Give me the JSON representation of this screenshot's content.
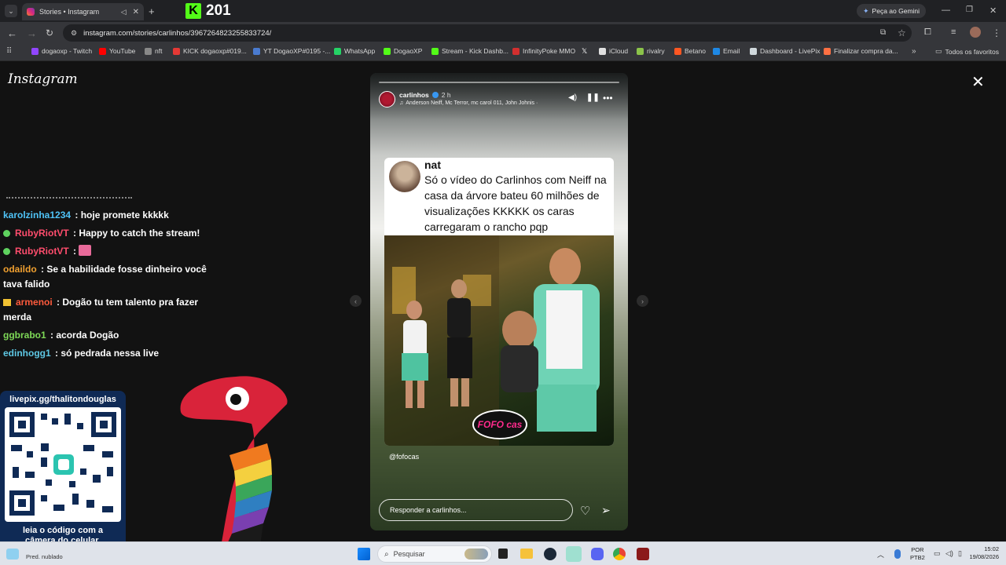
{
  "browser": {
    "tab_title": "Stories • Instagram",
    "url": "instagram.com/stories/carlinhos/3967264823255833724/",
    "gemini_label": "Peça ao Gemini",
    "kick_count": "201",
    "bookmarks": [
      {
        "label": "dogaoxp - Twitch",
        "color": "#9146ff"
      },
      {
        "label": "YouTube",
        "color": "#ff0000"
      },
      {
        "label": "nft",
        "color": "#888888"
      },
      {
        "label": "KICK dogaoxp#019...",
        "color": "#e53935"
      },
      {
        "label": "YT DogaoXP#0195 -...",
        "color": "#4a7bd0"
      },
      {
        "label": "WhatsApp",
        "color": "#25d366"
      },
      {
        "label": "DogaoXP",
        "color": "#53fc18"
      },
      {
        "label": "Stream - Kick Dashb...",
        "color": "#53fc18"
      },
      {
        "label": "InfinityPoke MMO",
        "color": "#d32f2f"
      },
      {
        "label": "",
        "color": "#dddddd"
      },
      {
        "label": "iCloud",
        "color": "#e0e0e0"
      },
      {
        "label": "rivalry",
        "color": "#8bc34a"
      },
      {
        "label": "Betano",
        "color": "#ff5722"
      },
      {
        "label": "Email",
        "color": "#1e88e5"
      },
      {
        "label": "Dashboard - LivePix",
        "color": "#cfd8dc"
      },
      {
        "label": "Finalizar compra da...",
        "color": "#ff7043"
      }
    ],
    "all_bookmarks": "Todos os favoritos"
  },
  "instagram": {
    "logo": "Instagram"
  },
  "chat": [
    {
      "user": "karolzinha1234",
      "color": "#4fc3f7",
      "badge": false,
      "text": ": hoje promete kkkkk"
    },
    {
      "user": "RubyRiotVT",
      "color": "#ff4d6d",
      "badge": true,
      "text": ": Happy to catch the stream!"
    },
    {
      "user": "RubyRiotVT",
      "color": "#ff4d6d",
      "badge": true,
      "text": ":"
    },
    {
      "user": "odaildo",
      "color": "#f0a030",
      "badge": false,
      "text": ": Se a habilidade fosse dinheiro você tava falido"
    },
    {
      "user": "armenoi",
      "color": "#ff5a3c",
      "badge": true,
      "text": ": Dogão tu tem talento pra fazer merda"
    },
    {
      "user": "ggbrabo1",
      "color": "#7ed957",
      "badge": false,
      "text": ": acorda Dogão"
    },
    {
      "user": "edinhogg1",
      "color": "#5ec8e5",
      "badge": false,
      "text": ": só pedrada nessa live"
    }
  ],
  "livepix": {
    "url": "livepix.gg/thalitondouglas",
    "caption": "leia o código com a câmera do celular."
  },
  "story": {
    "username": "carlinhos",
    "time": "2 h",
    "music": "Anderson Neiff, Mc Terror, mc carol 011, John Johnis ·",
    "tweet_user": "nat",
    "tweet_text": "Só o vídeo do Carlinhos com Neiff na casa da árvore bateu 60 milhões de visualizações KKKKK os caras carregaram o rancho pqp",
    "watermark": "FOFO cas",
    "credit": "@fofocas",
    "reply_placeholder": "Responder a carlinhos..."
  },
  "taskbar": {
    "weather": "Pred. nublado",
    "search": "Pesquisar",
    "lang": "POR",
    "lang2": "PTB2",
    "time": "15:02",
    "date": "19/08/2026"
  }
}
